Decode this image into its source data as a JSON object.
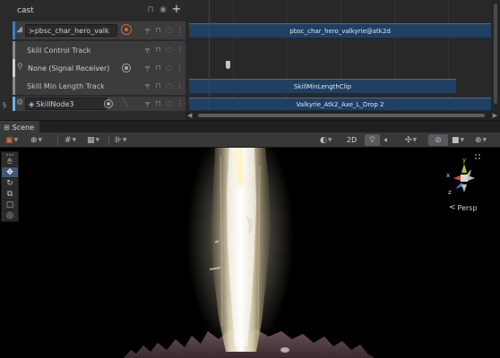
{
  "timeline": {
    "group_title": "cast",
    "tracks": [
      {
        "label": "≻pbsc_char_hero_valk",
        "kind": "animation",
        "stripe_color": "#3b7fc4"
      },
      {
        "label": "Skill Control Track",
        "kind": "control",
        "stripe_color": "#8a8a8a"
      },
      {
        "label": "None (Signal Receiver)",
        "kind": "signal",
        "stripe_color": "#cfcfcf"
      },
      {
        "label": "Skill Min Length Track",
        "kind": "control",
        "stripe_color": "#8a8a8a"
      },
      {
        "label": "SkillNode3",
        "kind": "skill",
        "stripe_color": "#6fb0e8"
      }
    ],
    "clips": [
      {
        "label": "pbsc_char_hero_valkyrie@atk2d"
      },
      {
        "label": "SkillMinLengthClip"
      },
      {
        "label": "Valkyrie_Atk2_Axe_L_Drop 2"
      }
    ]
  },
  "scene": {
    "tab_label": "Scene",
    "toolbar": {
      "mode_2d": "2D",
      "draw_mode_icon": "shaded-sphere-icon",
      "lighting_icon": "lightbulb-icon",
      "audio_icon": "speaker-icon",
      "effects_icon": "effects-icon",
      "hidden_icon": "eye-slash-icon",
      "camera_icon": "camera-icon",
      "gizmos_icon": "globe-icon"
    },
    "gizmo": {
      "y_label": "y",
      "x_label": "x",
      "z_label": "z",
      "projection": "Persp"
    },
    "tools": [
      "hand",
      "move",
      "rotate",
      "scale",
      "rect",
      "transform"
    ]
  },
  "colors": {
    "accent": "#3e5a78",
    "clip": "#1f4062",
    "record": "#d06540",
    "axis_x": "#d9483b",
    "axis_y": "#9ccc3b",
    "axis_z": "#3b7fd6"
  }
}
